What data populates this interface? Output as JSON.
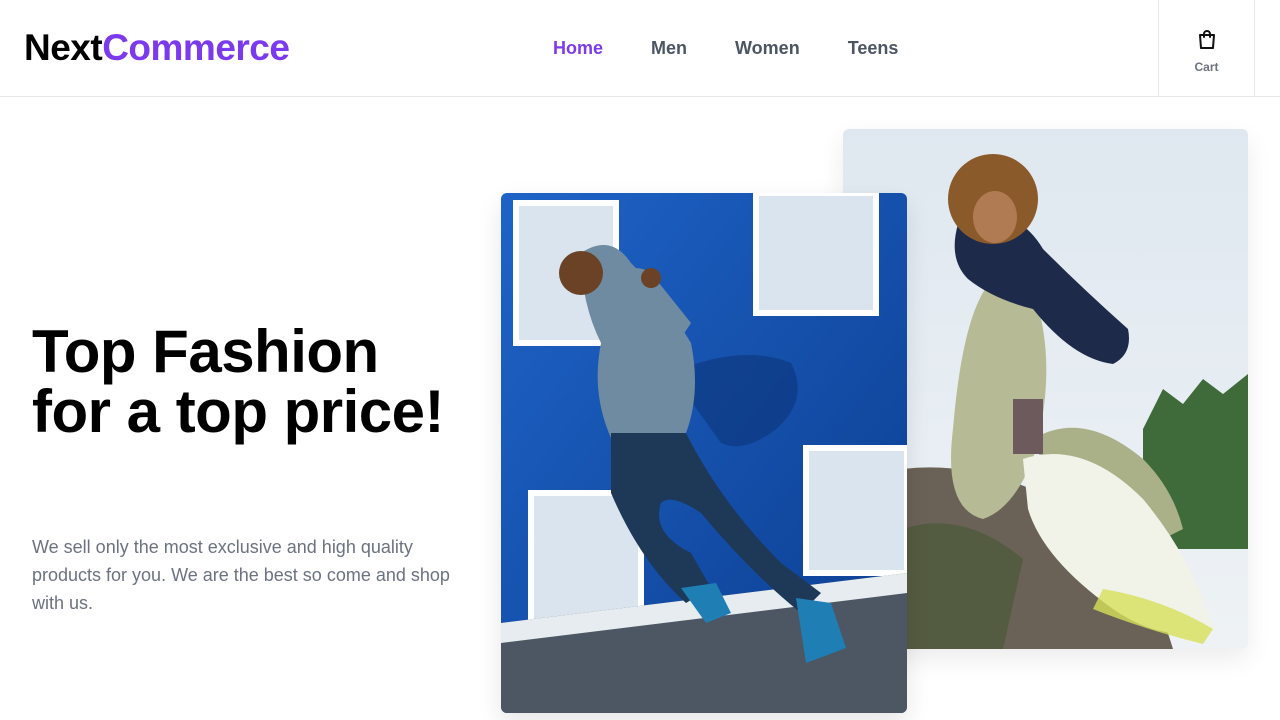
{
  "brand": {
    "part1": "Next",
    "part2": "Commerce"
  },
  "nav": {
    "items": [
      {
        "label": "Home",
        "active": true
      },
      {
        "label": "Men",
        "active": false
      },
      {
        "label": "Women",
        "active": false
      },
      {
        "label": "Teens",
        "active": false
      }
    ]
  },
  "cart": {
    "label": "Cart",
    "icon": "shopping-bag-icon"
  },
  "hero": {
    "title": "Top Fashion for a top price!",
    "description": "We sell only the most exclusive and high quality products for you. We are the best so come and shop with us."
  },
  "colors": {
    "accent": "#7c3aed",
    "text": "#000000",
    "muted": "#6b7280"
  }
}
